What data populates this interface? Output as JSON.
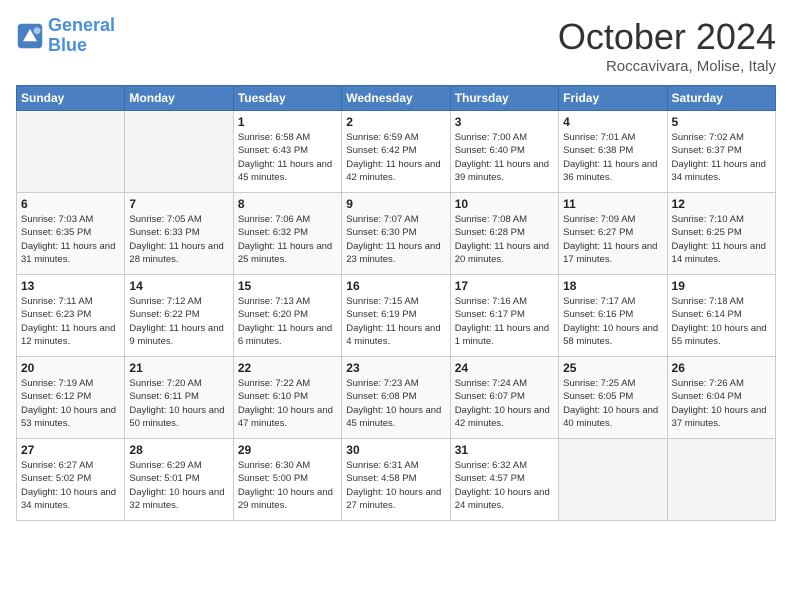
{
  "header": {
    "logo_line1": "General",
    "logo_line2": "Blue",
    "month_title": "October 2024",
    "location": "Roccavivara, Molise, Italy"
  },
  "days_of_week": [
    "Sunday",
    "Monday",
    "Tuesday",
    "Wednesday",
    "Thursday",
    "Friday",
    "Saturday"
  ],
  "weeks": [
    [
      {
        "day": "",
        "empty": true
      },
      {
        "day": "",
        "empty": true
      },
      {
        "day": "1",
        "sunrise": "Sunrise: 6:58 AM",
        "sunset": "Sunset: 6:43 PM",
        "daylight": "Daylight: 11 hours and 45 minutes."
      },
      {
        "day": "2",
        "sunrise": "Sunrise: 6:59 AM",
        "sunset": "Sunset: 6:42 PM",
        "daylight": "Daylight: 11 hours and 42 minutes."
      },
      {
        "day": "3",
        "sunrise": "Sunrise: 7:00 AM",
        "sunset": "Sunset: 6:40 PM",
        "daylight": "Daylight: 11 hours and 39 minutes."
      },
      {
        "day": "4",
        "sunrise": "Sunrise: 7:01 AM",
        "sunset": "Sunset: 6:38 PM",
        "daylight": "Daylight: 11 hours and 36 minutes."
      },
      {
        "day": "5",
        "sunrise": "Sunrise: 7:02 AM",
        "sunset": "Sunset: 6:37 PM",
        "daylight": "Daylight: 11 hours and 34 minutes."
      }
    ],
    [
      {
        "day": "6",
        "sunrise": "Sunrise: 7:03 AM",
        "sunset": "Sunset: 6:35 PM",
        "daylight": "Daylight: 11 hours and 31 minutes."
      },
      {
        "day": "7",
        "sunrise": "Sunrise: 7:05 AM",
        "sunset": "Sunset: 6:33 PM",
        "daylight": "Daylight: 11 hours and 28 minutes."
      },
      {
        "day": "8",
        "sunrise": "Sunrise: 7:06 AM",
        "sunset": "Sunset: 6:32 PM",
        "daylight": "Daylight: 11 hours and 25 minutes."
      },
      {
        "day": "9",
        "sunrise": "Sunrise: 7:07 AM",
        "sunset": "Sunset: 6:30 PM",
        "daylight": "Daylight: 11 hours and 23 minutes."
      },
      {
        "day": "10",
        "sunrise": "Sunrise: 7:08 AM",
        "sunset": "Sunset: 6:28 PM",
        "daylight": "Daylight: 11 hours and 20 minutes."
      },
      {
        "day": "11",
        "sunrise": "Sunrise: 7:09 AM",
        "sunset": "Sunset: 6:27 PM",
        "daylight": "Daylight: 11 hours and 17 minutes."
      },
      {
        "day": "12",
        "sunrise": "Sunrise: 7:10 AM",
        "sunset": "Sunset: 6:25 PM",
        "daylight": "Daylight: 11 hours and 14 minutes."
      }
    ],
    [
      {
        "day": "13",
        "sunrise": "Sunrise: 7:11 AM",
        "sunset": "Sunset: 6:23 PM",
        "daylight": "Daylight: 11 hours and 12 minutes."
      },
      {
        "day": "14",
        "sunrise": "Sunrise: 7:12 AM",
        "sunset": "Sunset: 6:22 PM",
        "daylight": "Daylight: 11 hours and 9 minutes."
      },
      {
        "day": "15",
        "sunrise": "Sunrise: 7:13 AM",
        "sunset": "Sunset: 6:20 PM",
        "daylight": "Daylight: 11 hours and 6 minutes."
      },
      {
        "day": "16",
        "sunrise": "Sunrise: 7:15 AM",
        "sunset": "Sunset: 6:19 PM",
        "daylight": "Daylight: 11 hours and 4 minutes."
      },
      {
        "day": "17",
        "sunrise": "Sunrise: 7:16 AM",
        "sunset": "Sunset: 6:17 PM",
        "daylight": "Daylight: 11 hours and 1 minute."
      },
      {
        "day": "18",
        "sunrise": "Sunrise: 7:17 AM",
        "sunset": "Sunset: 6:16 PM",
        "daylight": "Daylight: 10 hours and 58 minutes."
      },
      {
        "day": "19",
        "sunrise": "Sunrise: 7:18 AM",
        "sunset": "Sunset: 6:14 PM",
        "daylight": "Daylight: 10 hours and 55 minutes."
      }
    ],
    [
      {
        "day": "20",
        "sunrise": "Sunrise: 7:19 AM",
        "sunset": "Sunset: 6:12 PM",
        "daylight": "Daylight: 10 hours and 53 minutes."
      },
      {
        "day": "21",
        "sunrise": "Sunrise: 7:20 AM",
        "sunset": "Sunset: 6:11 PM",
        "daylight": "Daylight: 10 hours and 50 minutes."
      },
      {
        "day": "22",
        "sunrise": "Sunrise: 7:22 AM",
        "sunset": "Sunset: 6:10 PM",
        "daylight": "Daylight: 10 hours and 47 minutes."
      },
      {
        "day": "23",
        "sunrise": "Sunrise: 7:23 AM",
        "sunset": "Sunset: 6:08 PM",
        "daylight": "Daylight: 10 hours and 45 minutes."
      },
      {
        "day": "24",
        "sunrise": "Sunrise: 7:24 AM",
        "sunset": "Sunset: 6:07 PM",
        "daylight": "Daylight: 10 hours and 42 minutes."
      },
      {
        "day": "25",
        "sunrise": "Sunrise: 7:25 AM",
        "sunset": "Sunset: 6:05 PM",
        "daylight": "Daylight: 10 hours and 40 minutes."
      },
      {
        "day": "26",
        "sunrise": "Sunrise: 7:26 AM",
        "sunset": "Sunset: 6:04 PM",
        "daylight": "Daylight: 10 hours and 37 minutes."
      }
    ],
    [
      {
        "day": "27",
        "sunrise": "Sunrise: 6:27 AM",
        "sunset": "Sunset: 5:02 PM",
        "daylight": "Daylight: 10 hours and 34 minutes."
      },
      {
        "day": "28",
        "sunrise": "Sunrise: 6:29 AM",
        "sunset": "Sunset: 5:01 PM",
        "daylight": "Daylight: 10 hours and 32 minutes."
      },
      {
        "day": "29",
        "sunrise": "Sunrise: 6:30 AM",
        "sunset": "Sunset: 5:00 PM",
        "daylight": "Daylight: 10 hours and 29 minutes."
      },
      {
        "day": "30",
        "sunrise": "Sunrise: 6:31 AM",
        "sunset": "Sunset: 4:58 PM",
        "daylight": "Daylight: 10 hours and 27 minutes."
      },
      {
        "day": "31",
        "sunrise": "Sunrise: 6:32 AM",
        "sunset": "Sunset: 4:57 PM",
        "daylight": "Daylight: 10 hours and 24 minutes."
      },
      {
        "day": "",
        "empty": true
      },
      {
        "day": "",
        "empty": true
      }
    ]
  ]
}
